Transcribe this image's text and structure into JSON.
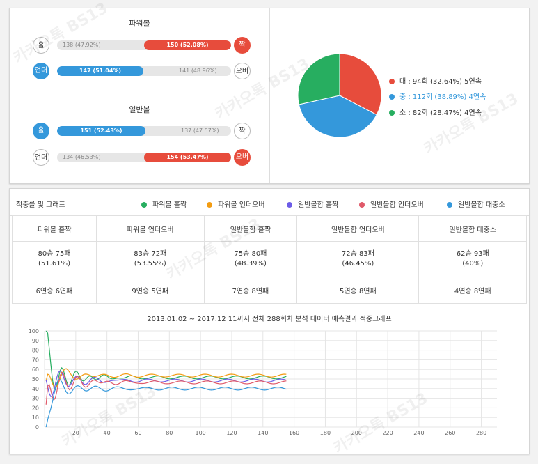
{
  "top": {
    "powerball": {
      "title": "파워볼",
      "rows": [
        {
          "left_label": "홀",
          "left_style": "w",
          "right_label": "짝",
          "right_style": "r",
          "bar_side": "r",
          "fill_pct": 52.08,
          "fill_text": "150 (52.08%)",
          "gray_text": "138 (47.92%)"
        },
        {
          "left_label": "언더",
          "left_style": "b",
          "right_label": "오버",
          "right_style": "w",
          "bar_side": "b",
          "fill_pct": 51.04,
          "fill_text": "147 (51.04%)",
          "gray_text": "141 (48.96%)"
        }
      ]
    },
    "general": {
      "title": "일반볼",
      "rows": [
        {
          "left_label": "홀",
          "left_style": "b",
          "right_label": "짝",
          "right_style": "w",
          "bar_side": "b",
          "fill_pct": 52.43,
          "fill_text": "151 (52.43%)",
          "gray_text": "137 (47.57%)"
        },
        {
          "left_label": "언더",
          "left_style": "w",
          "right_label": "오버",
          "right_style": "r",
          "bar_side": "r",
          "fill_pct": 53.47,
          "fill_text": "154 (53.47%)",
          "gray_text": "134 (46.53%)"
        }
      ]
    },
    "pie": {
      "slices": [
        {
          "label": "대 : 94회 (32.64%) 5연속",
          "value": 32.64,
          "color": "#e74c3c",
          "text_color": "#333333"
        },
        {
          "label": "중 : 112회 (38.89%) 4연속",
          "value": 38.89,
          "color": "#3498db",
          "text_color": "#3498db"
        },
        {
          "label": "소 : 82회 (28.47%) 4연속",
          "value": 28.47,
          "color": "#27ae60",
          "text_color": "#333333"
        }
      ]
    }
  },
  "bottom": {
    "title": "적중률 및 그래프",
    "legend": [
      {
        "label": "파워볼 홀짝",
        "color": "#27ae60"
      },
      {
        "label": "파워볼 언더오버",
        "color": "#f39c12"
      },
      {
        "label": "일반볼합 홀짝",
        "color": "#6c5ce7"
      },
      {
        "label": "일반볼합 언더오버",
        "color": "#e05a6a"
      },
      {
        "label": "일반볼합 대중소",
        "color": "#3498db"
      }
    ],
    "table": {
      "headers": [
        "파워볼 홀짝",
        "파워볼 언더오버",
        "일반볼합 홀짝",
        "일반볼합 언더오버",
        "일반볼합 대중소"
      ],
      "records": [
        {
          "line1": "80승 75패",
          "line2": "(51.61%)"
        },
        {
          "line1": "83승 72패",
          "line2": "(53.55%)"
        },
        {
          "line1": "75승 80패",
          "line2": "(48.39%)"
        },
        {
          "line1": "72승 83패",
          "line2": "(46.45%)"
        },
        {
          "line1": "62승 93패",
          "line2": "(40%)"
        }
      ],
      "streaks": [
        "6연승 6연패",
        "9연승 5연패",
        "7연승 8연패",
        "5연승 8연패",
        "4연승 8연패"
      ]
    },
    "chart_title": "2013.01.02 ~ 2017.12 11까지 전체 288회차 분석 데이터 예측결과 적중그래프"
  },
  "watermark": "카카오톡 BS13",
  "chart_data": {
    "type": "line",
    "x_ticks": [
      0,
      20,
      40,
      60,
      80,
      100,
      120,
      140,
      160,
      180,
      200,
      220,
      240,
      260,
      280
    ],
    "y_ticks": [
      0,
      10,
      20,
      30,
      40,
      50,
      60,
      70,
      80,
      90,
      100
    ],
    "xlim": [
      0,
      290
    ],
    "ylim": [
      0,
      100
    ],
    "grid": true,
    "series": [
      {
        "name": "파워볼 홀짝",
        "color": "#27ae60",
        "start": 100,
        "end": 51.61,
        "amp": 22,
        "period": 9,
        "phase": 0.0
      },
      {
        "name": "파워볼 언더오버",
        "color": "#f39c12",
        "start": 30,
        "end": 53.55,
        "amp": 18,
        "period": 13,
        "phase": 1.2
      },
      {
        "name": "일반볼합 홀짝",
        "color": "#6c5ce7",
        "start": 40,
        "end": 48.39,
        "amp": 20,
        "period": 11,
        "phase": 2.1
      },
      {
        "name": "일반볼합 언더오버",
        "color": "#e05a6a",
        "start": 0,
        "end": 46.45,
        "amp": 24,
        "period": 10,
        "phase": 0.7
      },
      {
        "name": "일반볼합 대중소",
        "color": "#3498db",
        "start": 0,
        "end": 40,
        "amp": 18,
        "period": 12,
        "phase": 2.8
      }
    ],
    "n_points": 155
  }
}
